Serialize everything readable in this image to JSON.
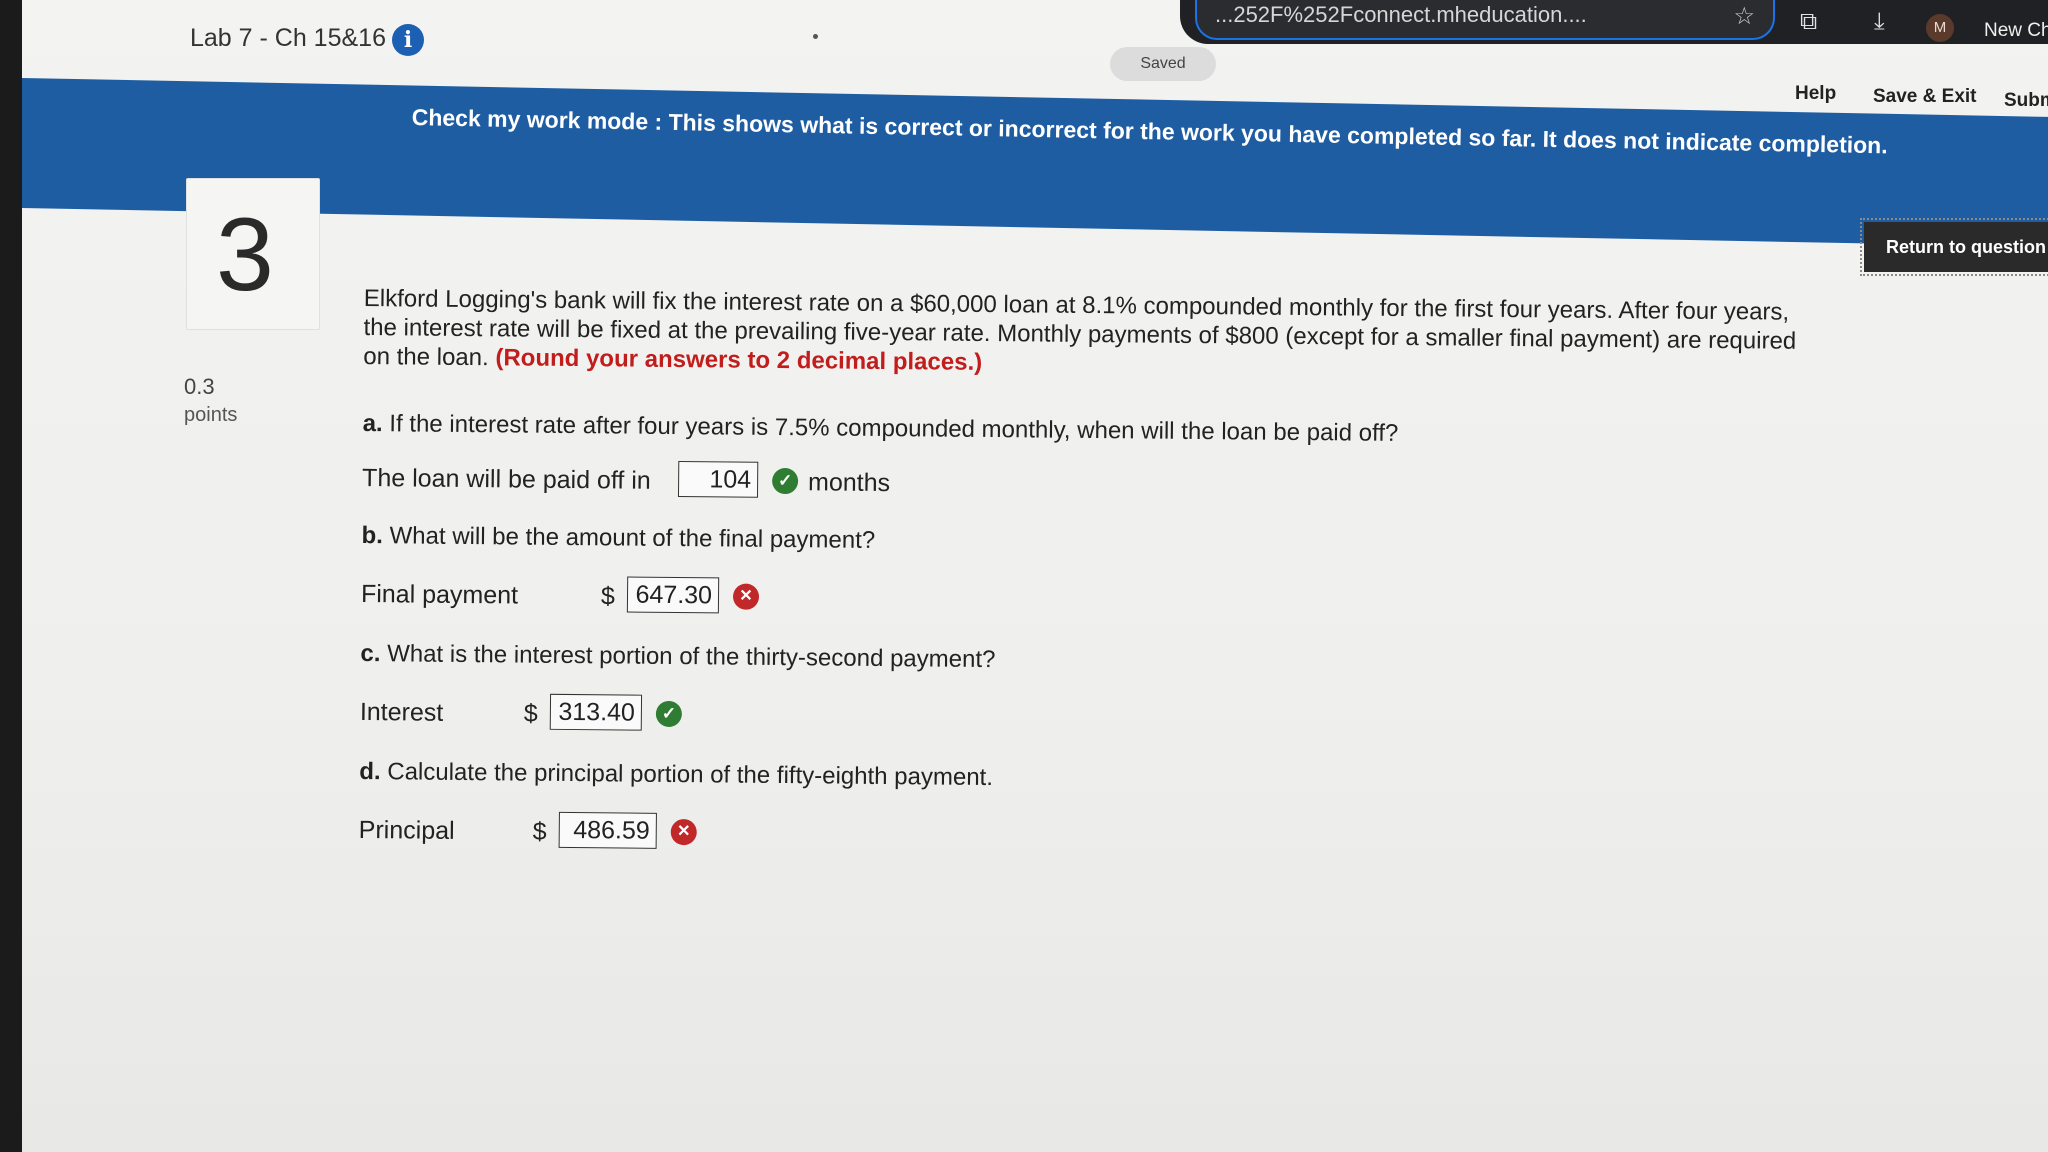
{
  "browser": {
    "url_fragment": "...252F%252Fconnect.mheducation....",
    "profile_initial": "M",
    "new_chrome": "New Ch"
  },
  "header": {
    "lab_title": "Lab 7 - Ch 15&16",
    "saved_status": "Saved",
    "help": "Help",
    "save_exit": "Save & Exit",
    "submit": "Subm"
  },
  "banner": {
    "text": "Check my work mode : This shows what is correct or incorrect for the work you have completed so far. It does not indicate completion."
  },
  "question": {
    "number": "3",
    "points_value": "0.3",
    "points_label": "points",
    "return_button": "Return to question",
    "stem": "Elkford Logging's bank will fix the interest rate on a $60,000 loan at 8.1% compounded monthly for the first four years. After four years, the interest rate will be fixed at the prevailing five-year rate. Monthly payments of $800 (except for a smaller final payment) are required on the loan.",
    "round_note": "(Round your answers to 2 decimal places.)",
    "parts": [
      {
        "letter": "a.",
        "prompt": "If the interest rate after four years is 7.5% compounded monthly, when will the loan be paid off?",
        "answer_label": "The loan will be paid off in",
        "answer_value": "104",
        "unit": "months",
        "status": "correct"
      },
      {
        "letter": "b.",
        "prompt": "What will be the amount of the final payment?",
        "answer_label": "Final payment",
        "currency": "$",
        "answer_value": "647.30",
        "status": "incorrect"
      },
      {
        "letter": "c.",
        "prompt": "What is the interest portion of the thirty-second payment?",
        "answer_label": "Interest",
        "currency": "$",
        "answer_value": "313.40",
        "status": "correct"
      },
      {
        "letter": "d.",
        "prompt": "Calculate the principal portion of the fifty-eighth payment.",
        "answer_label": "Principal",
        "currency": "$",
        "answer_value": "486.59",
        "status": "incorrect"
      }
    ]
  },
  "colors": {
    "banner_blue": "#1f5da3",
    "correct_green": "#2f7d32",
    "incorrect_red": "#c0282a",
    "note_red": "#c21d1d"
  }
}
